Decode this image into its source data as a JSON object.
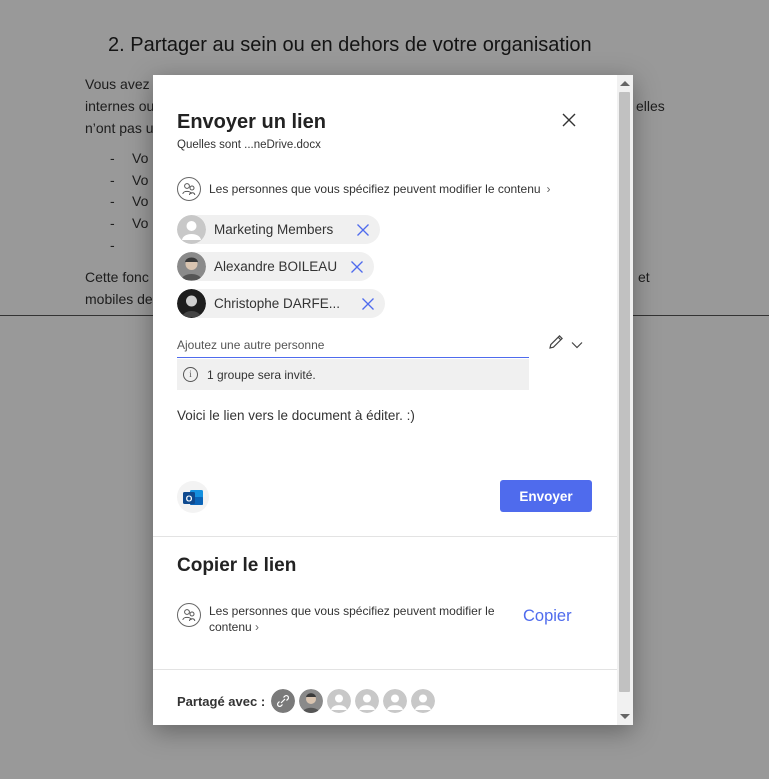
{
  "document": {
    "heading": "2. Partager au sein ou en dehors de votre organisation",
    "line1_start": "Vous avez",
    "line2_start": "internes ou",
    "line2_end": "elles",
    "line3_start": "n’ont pas u",
    "bullets": [
      "Vo",
      "Vo",
      "Vo",
      "Vo",
      ""
    ],
    "bullet_dash": "-",
    "line4_start": "Cette fonc",
    "line4_end": "et",
    "line5_start": "mobiles de"
  },
  "dialog": {
    "title": "Envoyer un lien",
    "file_name": "Quelles sont ...neDrive.docx",
    "permission": "Les personnes que vous spécifiez peuvent modifier le contenu",
    "recipients": [
      {
        "name": "Marketing Members",
        "avatar": "generic"
      },
      {
        "name": "Alexandre BOILEAU",
        "avatar": "photo"
      },
      {
        "name": "Christophe DARFE...",
        "avatar": "photo-dark"
      }
    ],
    "add_placeholder": "Ajoutez une autre personne",
    "info": "1 groupe sera invité.",
    "message": "Voici le lien vers le document à éditer. :)",
    "send_label": "Envoyer",
    "copy_title": "Copier le lien",
    "copy_permission_line1": "Les personnes que vous spécifiez peuvent modifier le",
    "copy_permission_line2": "contenu",
    "copy_label": "Copier",
    "shared_label": "Partagé avec :",
    "accent_color": "#4f6bed"
  }
}
